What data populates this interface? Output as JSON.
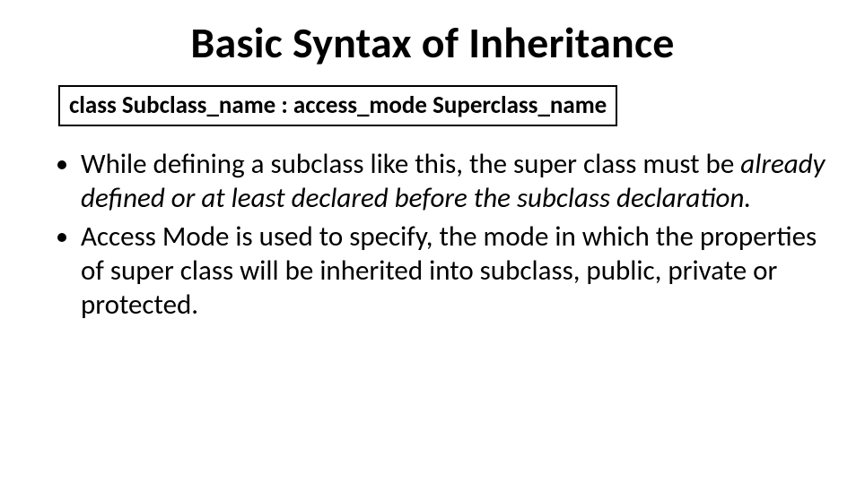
{
  "title": "Basic Syntax of Inheritance",
  "syntax": "class Subclass_name : access_mode Superclass_name",
  "bullets": [
    {
      "pre": "While defining a subclass like this, the super class must be ",
      "italic": "already defined or at least declared before the subclass declaration.",
      "post": ""
    },
    {
      "pre": "Access Mode is used to specify, the mode in which the properties of super class will be inherited into subclass, public, private or protected.",
      "italic": "",
      "post": ""
    }
  ]
}
